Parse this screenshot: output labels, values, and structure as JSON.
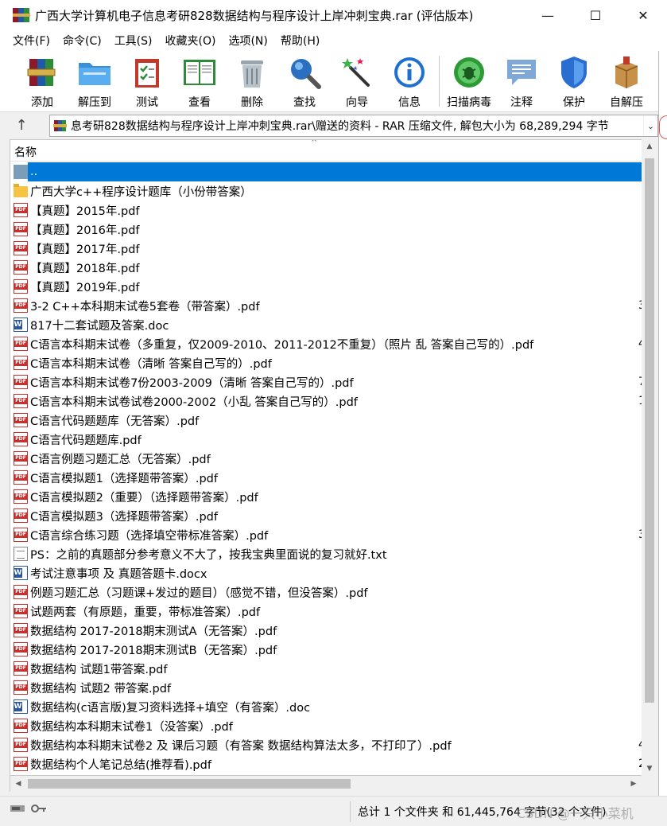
{
  "window": {
    "title": "广西大学计算机电子信息考研828数据结构与程序设计上岸冲刺宝典.rar (评估版本)",
    "controls": {
      "minimize": "—",
      "maximize": "☐",
      "close": "✕"
    }
  },
  "menu": [
    {
      "label": "文件(F)"
    },
    {
      "label": "命令(C)"
    },
    {
      "label": "工具(S)"
    },
    {
      "label": "收藏夹(O)"
    },
    {
      "label": "选项(N)"
    },
    {
      "label": "帮助(H)"
    }
  ],
  "toolbar": [
    {
      "label": "添加",
      "icon": "add-archive-icon"
    },
    {
      "label": "解压到",
      "icon": "extract-folder-icon"
    },
    {
      "label": "测试",
      "icon": "test-clipboard-icon"
    },
    {
      "label": "查看",
      "icon": "view-book-icon"
    },
    {
      "label": "删除",
      "icon": "delete-trash-icon"
    },
    {
      "label": "查找",
      "icon": "find-magnifier-icon"
    },
    {
      "label": "向导",
      "icon": "wizard-wand-icon"
    },
    {
      "label": "信息",
      "icon": "info-icon"
    },
    {
      "label": "扫描病毒",
      "icon": "virus-scan-icon"
    },
    {
      "label": "注释",
      "icon": "comment-icon"
    },
    {
      "label": "保护",
      "icon": "protect-shield-icon"
    },
    {
      "label": "自解压",
      "icon": "sfx-box-icon"
    }
  ],
  "address": {
    "path": "息考研828数据结构与程序设计上岸冲刺宝典.rar\\赠送的资料 - RAR 压缩文件, 解包大小为 68,289,294 字节"
  },
  "list": {
    "column_name": "名称",
    "rows": [
      {
        "name": "..",
        "type": "updir",
        "size": ""
      },
      {
        "name": "广西大学c++程序设计题库（小份带答案）",
        "type": "folder",
        "size": ""
      },
      {
        "name": "【真题】2015年.pdf",
        "type": "pdf",
        "size": ""
      },
      {
        "name": "【真题】2016年.pdf",
        "type": "pdf",
        "size": ""
      },
      {
        "name": "【真题】2017年.pdf",
        "type": "pdf",
        "size": ""
      },
      {
        "name": "【真题】2018年.pdf",
        "type": "pdf",
        "size": ""
      },
      {
        "name": "【真题】2019年.pdf",
        "type": "pdf",
        "size": ""
      },
      {
        "name": "3-2 C++本科期末试卷5套卷（带答案）.pdf",
        "type": "pdf",
        "size": "3"
      },
      {
        "name": "817十二套试题及答案.doc",
        "type": "doc",
        "size": ""
      },
      {
        "name": "C语言本科期末试卷（多重复，仅2009-2010、2011-2012不重复）（照片 乱 答案自己写的）.pdf",
        "type": "pdf",
        "size": "4"
      },
      {
        "name": "C语言本科期末试卷（清晰 答案自己写的）.pdf",
        "type": "pdf",
        "size": ""
      },
      {
        "name": "C语言本科期末试卷7份2003-2009（清晰 答案自己写的）.pdf",
        "type": "pdf",
        "size": "7"
      },
      {
        "name": "C语言本科期末试卷试卷2000-2002（小乱 答案自己写的）.pdf",
        "type": "pdf",
        "size": "1"
      },
      {
        "name": "C语言代码题题库（无答案）.pdf",
        "type": "pdf",
        "size": ""
      },
      {
        "name": "C语言代码题题库.pdf",
        "type": "pdf",
        "size": ""
      },
      {
        "name": "C语言例题习题汇总（无答案）.pdf",
        "type": "pdf",
        "size": ""
      },
      {
        "name": "C语言模拟题1（选择题带答案）.pdf",
        "type": "pdf",
        "size": ""
      },
      {
        "name": "C语言模拟题2（重要）（选择题带答案）.pdf",
        "type": "pdf",
        "size": ""
      },
      {
        "name": "C语言模拟题3（选择题带答案）.pdf",
        "type": "pdf",
        "size": ""
      },
      {
        "name": "C语言综合练习题（选择填空带标准答案）.pdf",
        "type": "pdf",
        "size": "3"
      },
      {
        "name": "PS：之前的真题部分参考意义不大了，按我宝典里面说的复习就好.txt",
        "type": "txt",
        "size": ""
      },
      {
        "name": "考试注意事项 及 真题答题卡.docx",
        "type": "doc",
        "size": ""
      },
      {
        "name": "例题习题汇总（习题课+发过的题目）（感觉不错，但没答案）.pdf",
        "type": "pdf",
        "size": ""
      },
      {
        "name": "试题两套（有原题，重要，带标准答案）.pdf",
        "type": "pdf",
        "size": ""
      },
      {
        "name": "数据结构 2017-2018期末测试A（无答案）.pdf",
        "type": "pdf",
        "size": ""
      },
      {
        "name": "数据结构 2017-2018期末测试B（无答案）.pdf",
        "type": "pdf",
        "size": ""
      },
      {
        "name": "数据结构 试题1带答案.pdf",
        "type": "pdf",
        "size": ""
      },
      {
        "name": "数据结构 试题2 带答案.pdf",
        "type": "pdf",
        "size": ""
      },
      {
        "name": "数据结构(c语言版)复习资料选择+填空（有答案）.doc",
        "type": "doc",
        "size": ""
      },
      {
        "name": "数据结构本科期末试卷1（没答案）.pdf",
        "type": "pdf",
        "size": ""
      },
      {
        "name": "数据结构本科期末试卷2 及 课后习题（有答案 数据结构算法太多，不打印了）.pdf",
        "type": "pdf",
        "size": "4"
      },
      {
        "name": "数据结构个人笔记总结(推荐看).pdf",
        "type": "pdf",
        "size": "2"
      }
    ]
  },
  "status": {
    "summary": "总计 1 个文件夹 和 61,445,764 字节(32 个文件)",
    "watermark": "CSDN @一只小菜机"
  },
  "colors": {
    "selection": "#0078d7",
    "pdf": "#c9302c",
    "word": "#2b579a",
    "folder": "#f6c343"
  }
}
